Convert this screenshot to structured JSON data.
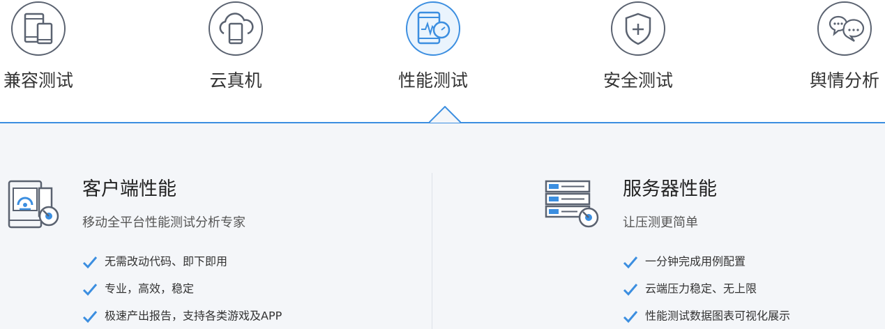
{
  "tabs": [
    {
      "label": "兼容测试",
      "icon": "devices-icon"
    },
    {
      "label": "云真机",
      "icon": "cloud-phone-icon"
    },
    {
      "label": "性能测试",
      "icon": "performance-icon",
      "active": true
    },
    {
      "label": "安全测试",
      "icon": "shield-plus-icon"
    },
    {
      "label": "舆情分析",
      "icon": "chat-bubbles-icon"
    }
  ],
  "client": {
    "title": "客户端性能",
    "subtitle": "移动全平台性能测试分析专家",
    "features": [
      "无需改动代码、即下即用",
      "专业，高效，稳定",
      "极速产出报告，支持各类游戏及APP"
    ]
  },
  "server": {
    "title": "服务器性能",
    "subtitle": "让压测更简单",
    "features": [
      "一分钟完成用例配置",
      "云端压力稳定、无上限",
      "性能测试数据图表可视化展示"
    ]
  },
  "colors": {
    "accent": "#3b8ee0",
    "icon_gray": "#5a6270",
    "panel_bg": "#f4f6f9"
  }
}
